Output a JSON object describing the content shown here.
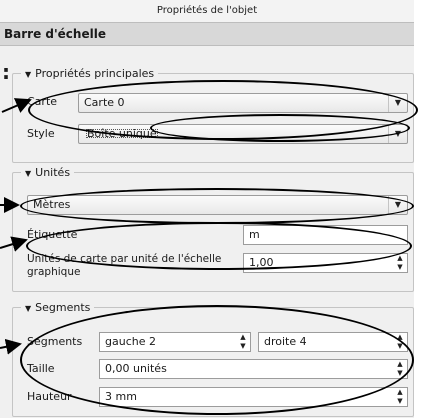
{
  "window": {
    "title": "Propriétés de l'objet"
  },
  "panel": {
    "heading": "Barre d'échelle"
  },
  "margin_glyph": ":",
  "main_props": {
    "title": "Propriétés principales",
    "map_label": "Carte",
    "map_value": "Carte 0",
    "style_label": "Style",
    "style_value": "Boîte unique"
  },
  "units": {
    "title": "Unités",
    "unit_value": "Mètres",
    "label_label": "Étiquette",
    "label_value": "m",
    "map_units_label_line1": "Unités de carte par unité de l'échelle",
    "map_units_label_line2": "graphique",
    "map_units_value": "1,00"
  },
  "segments": {
    "title": "Segments",
    "segments_label": "Segments",
    "left_value": "gauche 2",
    "right_value": "droite 4",
    "size_label": "Taille",
    "size_value": "0,00 unités",
    "height_label": "Hauteur",
    "height_value": "3 mm"
  },
  "icons": {
    "collapse": "▼",
    "dropdown": "▼",
    "spin_up": "▲",
    "spin_down": "▼"
  }
}
